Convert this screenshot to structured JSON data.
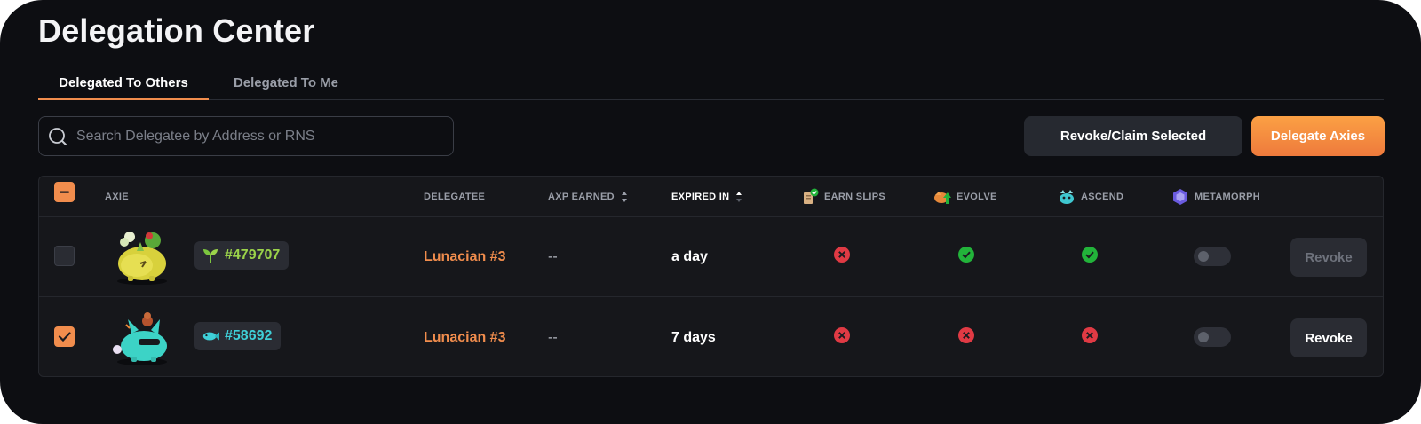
{
  "page": {
    "title": "Delegation Center"
  },
  "tabs": [
    {
      "label": "Delegated To Others",
      "active": true
    },
    {
      "label": "Delegated To Me",
      "active": false
    }
  ],
  "search": {
    "placeholder": "Search Delegatee by Address or RNS",
    "value": ""
  },
  "actions": {
    "revoke_claim_label": "Revoke/Claim Selected",
    "delegate_label": "Delegate Axies"
  },
  "table": {
    "headers": {
      "axie": "AXIE",
      "delegatee": "DELEGATEE",
      "axp_earned": "AXP EARNED",
      "expired_in": "EXPIRED IN",
      "earn_slips": "EARN SLIPS",
      "evolve": "EVOLVE",
      "ascend": "ASCEND",
      "metamorph": "METAMORPH"
    },
    "sort": {
      "active_column": "expired_in"
    },
    "rows": [
      {
        "selected": false,
        "axie_id": "#479707",
        "axie_class": "plant",
        "axie_icon": "sprout-icon",
        "delegatee": "Lunacian #3",
        "axp_earned": "--",
        "expired_in": "a day",
        "earn_slips": false,
        "evolve": true,
        "ascend": true,
        "metamorph": false,
        "revoke_label": "Revoke",
        "revoke_enabled": false
      },
      {
        "selected": true,
        "axie_id": "#58692",
        "axie_class": "aquatic",
        "axie_icon": "fish-icon",
        "delegatee": "Lunacian #3",
        "axp_earned": "--",
        "expired_in": "7 days",
        "earn_slips": false,
        "evolve": false,
        "ascend": false,
        "metamorph": false,
        "revoke_label": "Revoke",
        "revoke_enabled": true
      }
    ]
  },
  "colors": {
    "accent": "#f18d4d",
    "background": "#0d0e12",
    "success": "#22b33a",
    "error": "#e03a44",
    "plant": "#9bd34a",
    "aquatic": "#3fd0d8"
  }
}
